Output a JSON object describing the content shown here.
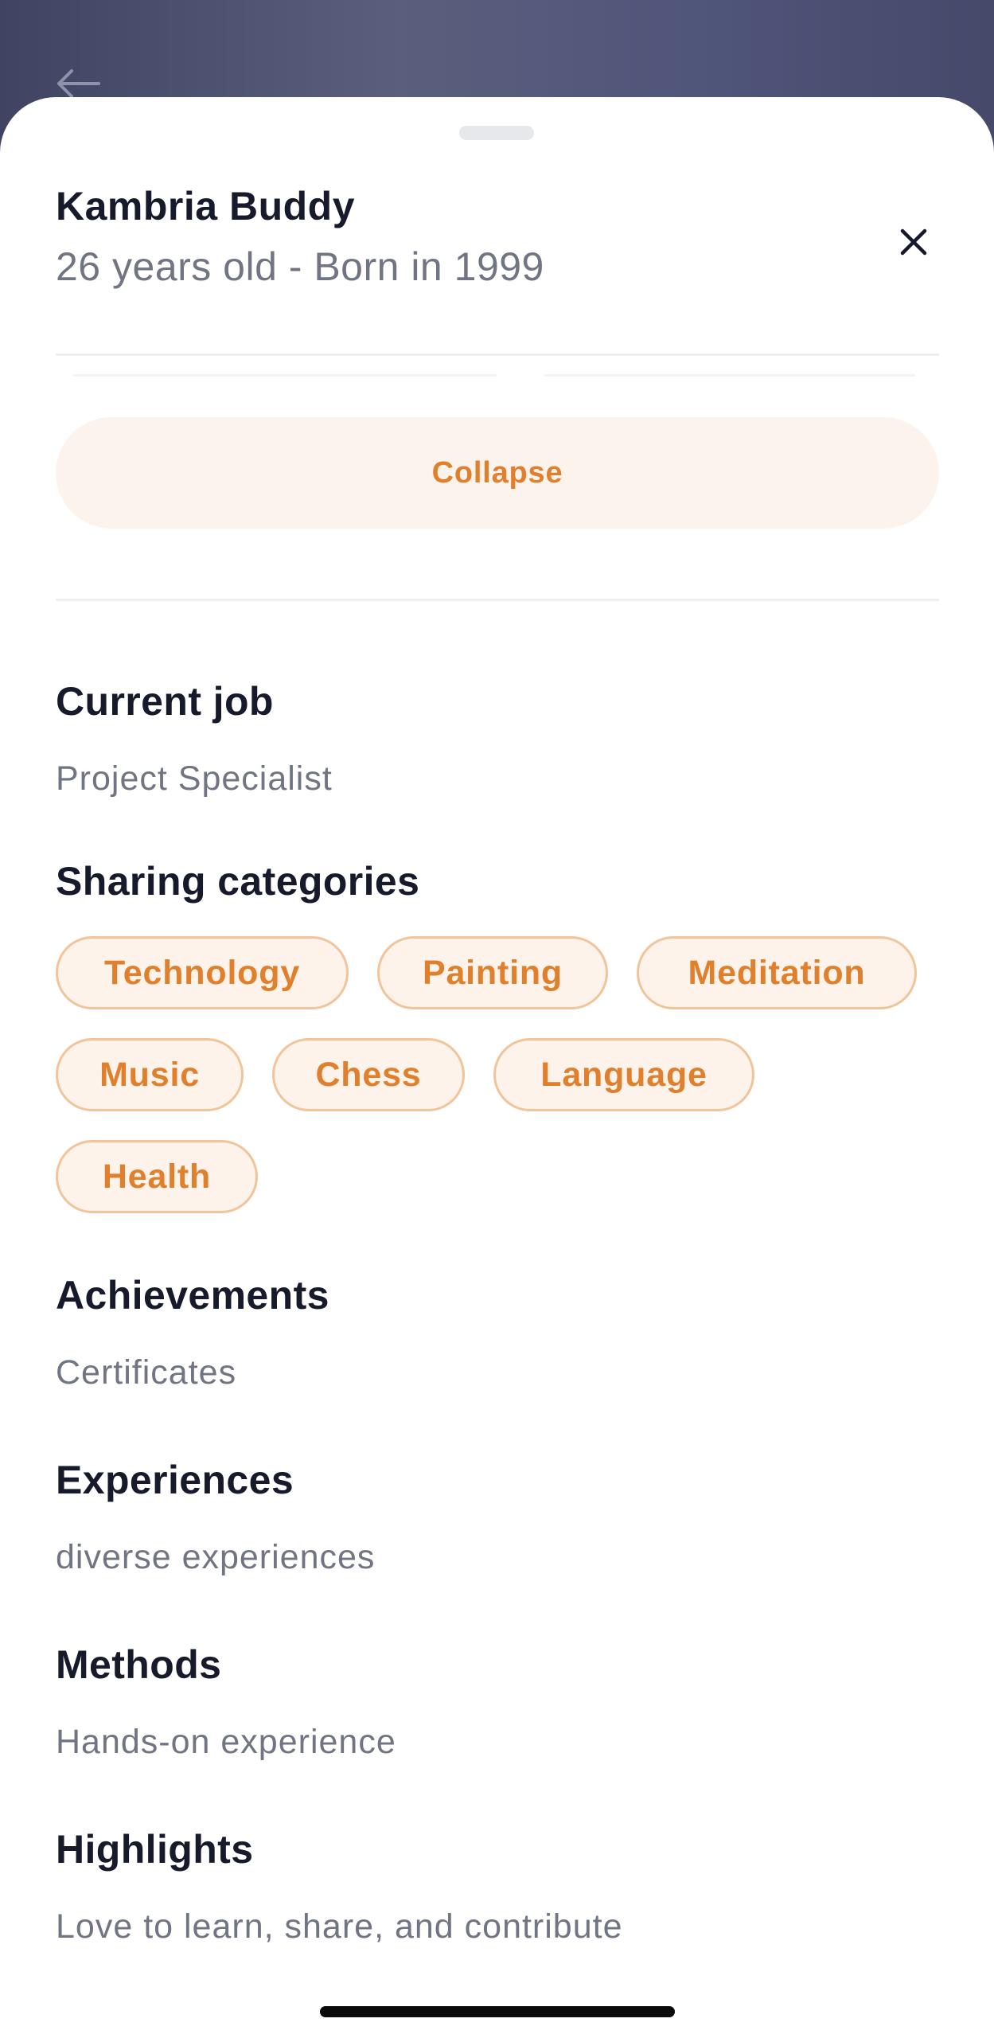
{
  "header": {
    "back_icon": "arrow-left-icon",
    "close_icon": "close-icon"
  },
  "profile": {
    "name": "Kambria Buddy",
    "age_line": "26 years old - Born in 1999"
  },
  "collapse_label": "Collapse",
  "sections": {
    "current_job": {
      "title": "Current job",
      "value": "Project Specialist"
    },
    "sharing_categories": {
      "title": "Sharing categories",
      "chips": [
        "Technology",
        "Painting",
        "Meditation",
        "Music",
        "Chess",
        "Language",
        "Health"
      ]
    },
    "achievements": {
      "title": "Achievements",
      "value": "Certificates"
    },
    "experiences": {
      "title": "Experiences",
      "value": "diverse experiences"
    },
    "methods": {
      "title": "Methods",
      "value": "Hands-on experience"
    },
    "highlights": {
      "title": "Highlights",
      "value": "Love to learn, share, and contribute"
    }
  },
  "colors": {
    "accent": "#e07f2c",
    "chip_bg": "#fdf3ea",
    "chip_border": "#f1c499",
    "title": "#161a2b",
    "muted": "#717482"
  }
}
